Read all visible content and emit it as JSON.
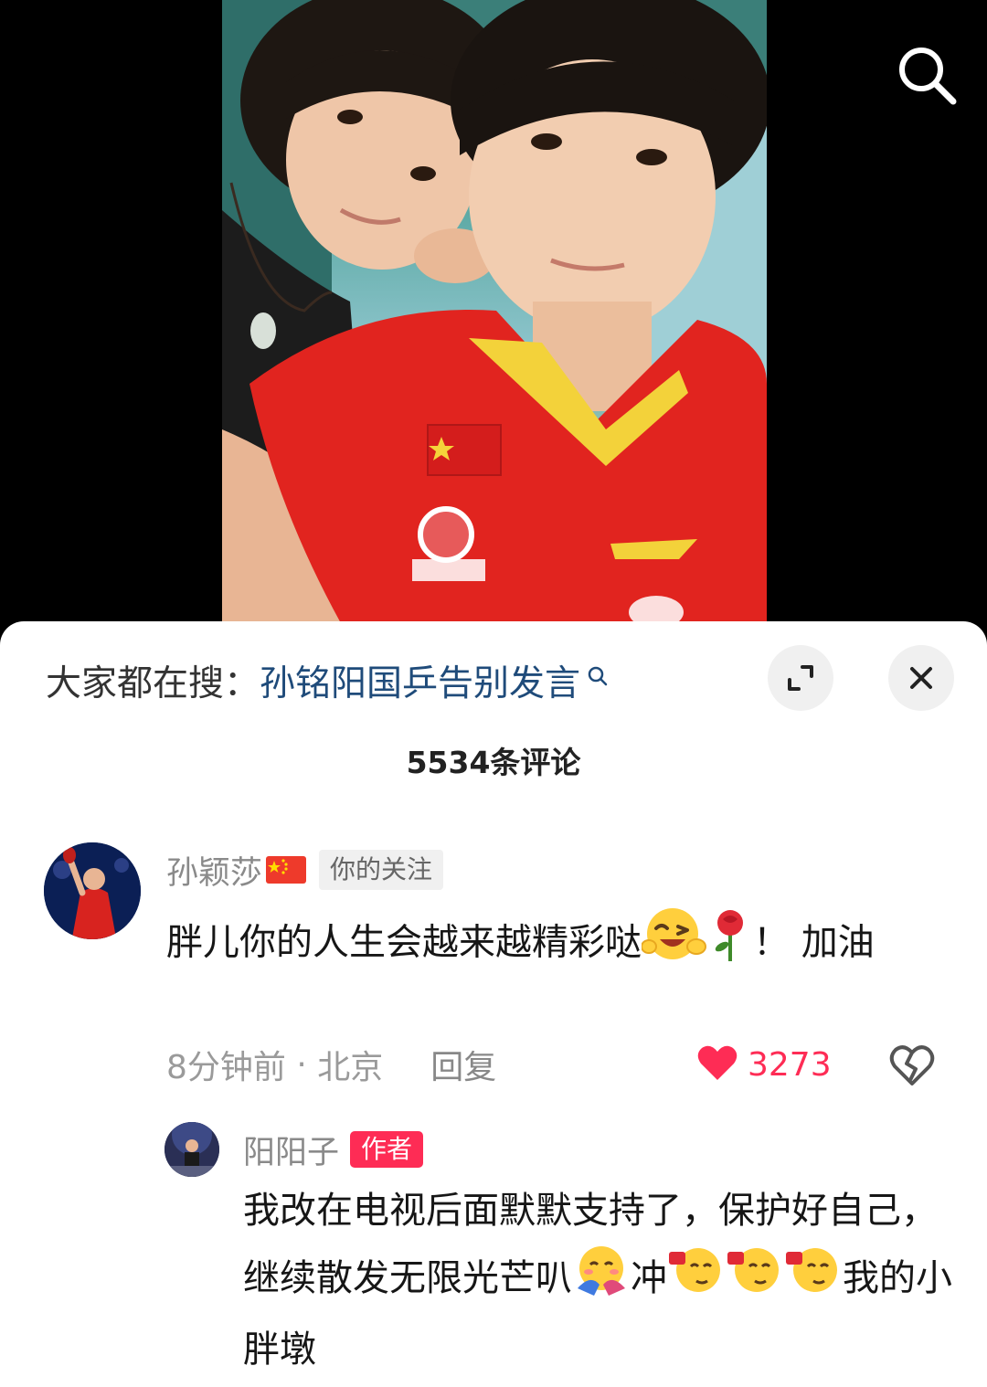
{
  "video": {
    "search_icon": "search-icon"
  },
  "hot_search": {
    "prefix": "大家都在搜：",
    "query": "孙铭阳国乒告别发言",
    "expand_icon": "expand-icon",
    "close_icon": "close-icon"
  },
  "comments": {
    "count_label": "5534条评论",
    "items": [
      {
        "username": "孙颖莎",
        "badge": "你的关注",
        "text_1": "胖儿你的人生会越来越精彩哒",
        "text_2": "！ 加油",
        "time": "8分钟前",
        "location": "北京",
        "reply_label": "回复",
        "likes": "3273",
        "liked": true
      }
    ],
    "reply": {
      "username": "阳阳子",
      "badge": "作者",
      "text_1": "我改在电视后面默默支持了，保护好自己，继续散发无限光芒叭",
      "text_2": "冲",
      "text_3": "我的小胖墩"
    }
  },
  "colors": {
    "like_red": "#fe2c55",
    "link_blue": "#1f4b7a"
  }
}
